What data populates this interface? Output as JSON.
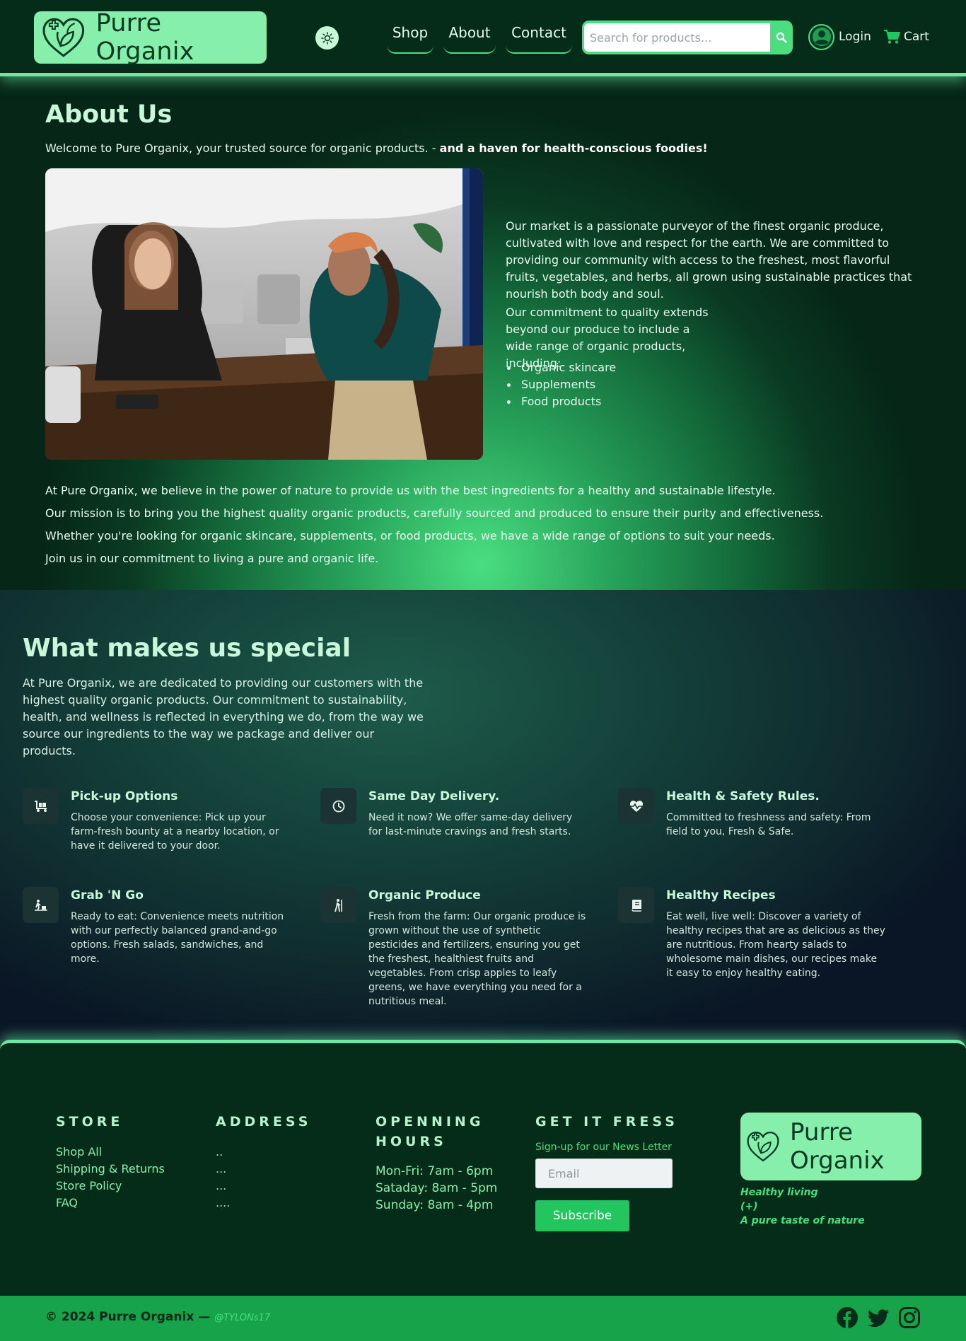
{
  "header": {
    "brand": "Purre Organix",
    "nav": [
      {
        "label": "Shop"
      },
      {
        "label": "About"
      },
      {
        "label": "Contact"
      }
    ],
    "search_placeholder": "Search for products...",
    "login_label": "Login",
    "cart_label": "Cart"
  },
  "about": {
    "title": "About Us",
    "welcome_text": "Welcome to Pure Organix, your trusted source for organic products. - ",
    "welcome_bold": "and a haven for health-conscious foodies!",
    "paragraph1": "Our market is a passionate purveyor of the finest organic produce, cultivated with love and respect for the earth. We are committed to providing our community with access to the freshest, most flavorful fruits, vegetables, and herbs, all grown using sustainable practices that nourish both body and soul.",
    "paragraph2": "Our commitment to quality extends beyond our produce to include a wide range of organic products, including:",
    "list": [
      "Organic skincare",
      "Supplements",
      "Food products"
    ],
    "closing": [
      "At Pure Organix, we believe in the power of nature to provide us with the best ingredients for a healthy and sustainable lifestyle.",
      "Our mission is to bring you the highest quality organic products, carefully sourced and produced to ensure their purity and effectiveness.",
      "Whether you're looking for organic skincare, supplements, or food products, we have a wide range of options to suit your needs.",
      "Join us in our commitment to living a pure and organic life."
    ]
  },
  "special": {
    "title": "What makes us special",
    "intro": "At Pure Organix, we are dedicated to providing our customers with the highest quality organic products. Our commitment to sustainability, health, and wellness is reflected in everything we do, from the way we source our ingredients to the way we package and deliver our products.",
    "features": [
      {
        "title": "Pick-up Options",
        "text": "Choose your convenience: Pick up your farm-fresh bounty at a nearby location, or have it delivered to your door.",
        "icon": "cart-flatbed-icon"
      },
      {
        "title": "Same Day Delivery.",
        "text": "Need it now? We offer same-day delivery for last-minute cravings and fresh starts.",
        "icon": "clock-icon"
      },
      {
        "title": "Health & Safety Rules.",
        "text": "Committed to freshness and safety: From field to you, Fresh & Safe.",
        "icon": "heart-pulse-icon"
      },
      {
        "title": "Grab 'N Go",
        "text": "Ready to eat: Convenience meets nutrition with our perfectly balanced grand-and-go options. Fresh salads, sandwiches, and more.",
        "icon": "person-walking-luggage-icon"
      },
      {
        "title": "Organic Produce",
        "text": "Fresh from the farm: Our organic produce is grown without the use of synthetic pesticides and fertilizers, ensuring you get the freshest, healthiest fruits and vegetables. From crisp apples to leafy greens, we have everything you need for a nutritious meal.",
        "icon": "farmer-icon"
      },
      {
        "title": "Healthy Recipes",
        "text": "Eat well, live well: Discover a variety of healthy recipes that are as delicious as they are nutritious. From hearty salads to wholesome main dishes, our recipes make it easy to enjoy healthy eating.",
        "icon": "book-icon"
      }
    ]
  },
  "footer": {
    "store": {
      "title": "STORE",
      "links": [
        "Shop All",
        "Shipping & Returns",
        "Store Policy",
        "FAQ"
      ]
    },
    "address": {
      "title": "ADDRESS",
      "lines": [
        "..",
        "...",
        "...",
        "...."
      ]
    },
    "hours": {
      "title_line1": "OPENNING",
      "title_line2": "HOURS",
      "lines": [
        "Mon-Fri: 7am - 6pm",
        "Sataday: 8am - 5pm",
        "Sunday: 8am - 4pm"
      ]
    },
    "newsletter": {
      "title": "GET IT FRESS",
      "label": "Sign-up for our News Letter",
      "email_placeholder": "Email",
      "button": "Subscribe"
    },
    "brand_line1": "Purre",
    "brand_line2": "Organix",
    "tagline": [
      "Healthy living",
      "(+)",
      "A pure taste of nature"
    ]
  },
  "bottom": {
    "copyright": "© 2024 Purre Organix — ",
    "handle": "@TYLONs17"
  },
  "colors": {
    "accent": "#4ade80",
    "logo_bg": "#86efac",
    "header_bg": "#052b19",
    "bottom_bar": "#16a34a",
    "button": "#22c55e"
  }
}
